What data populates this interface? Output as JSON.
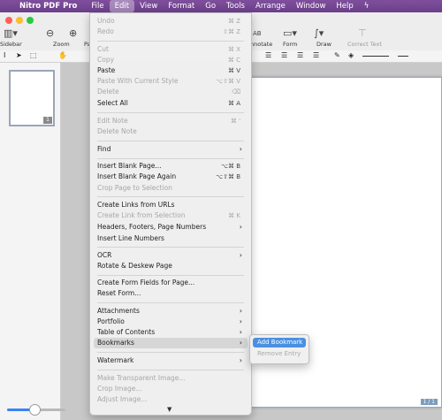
{
  "menubar": {
    "app_name": "Nitro PDF Pro",
    "items": [
      "File",
      "Edit",
      "View",
      "Format",
      "Go",
      "Tools",
      "Arrange",
      "Window",
      "Help"
    ]
  },
  "toolbar": {
    "labels": [
      "Sidebar",
      "Zoom",
      "Pa",
      "nnotate",
      "Form",
      "Draw",
      "Correct Text"
    ],
    "text_tool_label": "AB"
  },
  "sidebar": {
    "thumb_page_number": "1"
  },
  "canvas": {
    "page_indicator": "1 / 1",
    "zoom_level": 0.45
  },
  "edit_menu": {
    "items": [
      {
        "label": "Undo",
        "shortcut": "⌘ Z",
        "enabled": false
      },
      {
        "label": "Redo",
        "shortcut": "⇧⌘ Z",
        "enabled": false
      },
      {
        "label": "Cut",
        "shortcut": "⌘ X",
        "enabled": false
      },
      {
        "label": "Copy",
        "shortcut": "⌘ C",
        "enabled": false
      },
      {
        "label": "Paste",
        "shortcut": "⌘ V",
        "enabled": true
      },
      {
        "label": "Paste With Current Style",
        "shortcut": "⌥⇧⌘ V",
        "enabled": false
      },
      {
        "label": "Delete",
        "shortcut": "⌫",
        "enabled": false
      },
      {
        "label": "Select All",
        "shortcut": "⌘ A",
        "enabled": true
      },
      {
        "label": "Edit Note",
        "shortcut": "⌘ '",
        "enabled": false
      },
      {
        "label": "Delete Note",
        "shortcut": "",
        "enabled": false
      },
      {
        "label": "Find",
        "shortcut": "",
        "enabled": true,
        "submenu": true
      },
      {
        "label": "Insert Blank Page...",
        "shortcut": "⌥⌘ B",
        "enabled": true
      },
      {
        "label": "Insert Blank Page Again",
        "shortcut": "⌥⇧⌘ B",
        "enabled": true
      },
      {
        "label": "Crop Page to Selection",
        "shortcut": "",
        "enabled": false
      },
      {
        "label": "Create Links from URLs",
        "shortcut": "",
        "enabled": true
      },
      {
        "label": "Create Link from Selection",
        "shortcut": "⌘ K",
        "enabled": false
      },
      {
        "label": "Headers, Footers, Page Numbers",
        "shortcut": "",
        "enabled": true,
        "submenu": true
      },
      {
        "label": "Insert Line Numbers",
        "shortcut": "",
        "enabled": true
      },
      {
        "label": "OCR",
        "shortcut": "",
        "enabled": true,
        "submenu": true
      },
      {
        "label": "Rotate & Deskew Page",
        "shortcut": "",
        "enabled": true
      },
      {
        "label": "Create Form Fields for Page...",
        "shortcut": "",
        "enabled": true
      },
      {
        "label": "Reset Form...",
        "shortcut": "",
        "enabled": true
      },
      {
        "label": "Attachments",
        "shortcut": "",
        "enabled": true,
        "submenu": true
      },
      {
        "label": "Portfolio",
        "shortcut": "",
        "enabled": true,
        "submenu": true
      },
      {
        "label": "Table of Contents",
        "shortcut": "",
        "enabled": true,
        "submenu": true
      },
      {
        "label": "Bookmarks",
        "shortcut": "",
        "enabled": true,
        "submenu": true,
        "highlighted": true
      },
      {
        "label": "Watermark",
        "shortcut": "",
        "enabled": true,
        "submenu": true
      },
      {
        "label": "Make Transparent Image...",
        "shortcut": "",
        "enabled": false
      },
      {
        "label": "Crop Image...",
        "shortcut": "",
        "enabled": false
      },
      {
        "label": "Adjust Image...",
        "shortcut": "",
        "enabled": false
      }
    ]
  },
  "bookmarks_submenu": {
    "items": [
      {
        "label": "Add Bookmark",
        "enabled": true,
        "highlighted": true
      },
      {
        "label": "Remove Entry",
        "enabled": false
      }
    ]
  }
}
